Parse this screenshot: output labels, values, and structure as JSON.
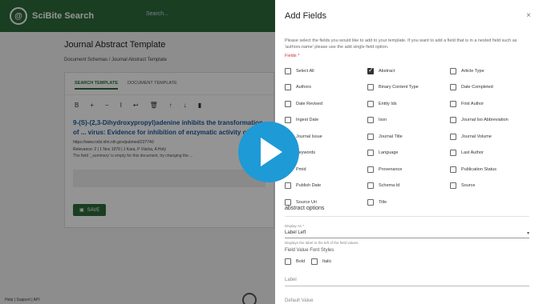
{
  "app": {
    "logo_text": "SciBite Search",
    "search_placeholder": "Search...",
    "page_title": "Journal Abstract Template",
    "breadcrumb": "Document Schemas  /  Journal Abstract Template",
    "tabs": [
      "SEARCH TEMPLATE",
      "DOCUMENT TEMPLATE"
    ],
    "toolbar": [
      "B",
      "+",
      "−",
      "I",
      "↩",
      "🗑",
      "↑",
      "↓",
      "▮"
    ],
    "doc_title": "9-(S)-(2,3-Dihydroxypropyl)adenine inhibits the transformation of ... virus: Evidence for inhibition of enzymatic activity of ...",
    "doc_url": "https://www.ncbi.nlm.nih.gov/pubmed/227740",
    "doc_meta": "Relevance: 2 | 1 Nov 1979 | J Kara, P Vácha, A Holý",
    "doc_note": "The field '_summary' is empty for this document, try changing the ...",
    "save_label": "SAVE",
    "footer": "Help | Support | API"
  },
  "drawer": {
    "title": "Add Fields",
    "close": "×",
    "description": "Please select the fields you would like to add to your template. If you want to add a field that is in a nested field such as 'authors.name' please use the add single field option.",
    "fields_label": "Fields *",
    "fields": [
      {
        "label": "Select All",
        "checked": false
      },
      {
        "label": "Abstract",
        "checked": true
      },
      {
        "label": "Article Type",
        "checked": false
      },
      {
        "label": "Authors",
        "checked": false
      },
      {
        "label": "Binary Content Type",
        "checked": false
      },
      {
        "label": "Date Completed",
        "checked": false
      },
      {
        "label": "Date Revised",
        "checked": false
      },
      {
        "label": "Entity Ids",
        "checked": false
      },
      {
        "label": "First Author",
        "checked": false
      },
      {
        "label": "Ingest Date",
        "checked": false
      },
      {
        "label": "Issn",
        "checked": false
      },
      {
        "label": "Journal Iso Abbreviation",
        "checked": false
      },
      {
        "label": "Journal Issue",
        "checked": false
      },
      {
        "label": "Journal Title",
        "checked": false
      },
      {
        "label": "Journal Volume",
        "checked": false
      },
      {
        "label": "Keywords",
        "checked": false
      },
      {
        "label": "Language",
        "checked": false
      },
      {
        "label": "Last Author",
        "checked": false
      },
      {
        "label": "Pmid",
        "checked": false
      },
      {
        "label": "Provenance",
        "checked": false
      },
      {
        "label": "Publication Status",
        "checked": false
      },
      {
        "label": "Publish Date",
        "checked": false
      },
      {
        "label": "Schema Id",
        "checked": false
      },
      {
        "label": "Source",
        "checked": false
      },
      {
        "label": "Source Uri",
        "checked": false
      },
      {
        "label": "Title",
        "checked": false
      }
    ],
    "options_title": "abstract options",
    "display_as_label": "Display As *",
    "display_as_value": "Label Left",
    "display_as_help": "Displays the label to the left of the field values.",
    "font_styles_label": "Field Value Font Styles",
    "font_styles": [
      "Bold",
      "Italic"
    ],
    "label_placeholder": "Label",
    "default_value_label": "Default Value"
  },
  "colors": {
    "brand_green": "#2e6b3a",
    "play_blue": "#1e9ad6",
    "link_blue": "#1a5aa0"
  }
}
